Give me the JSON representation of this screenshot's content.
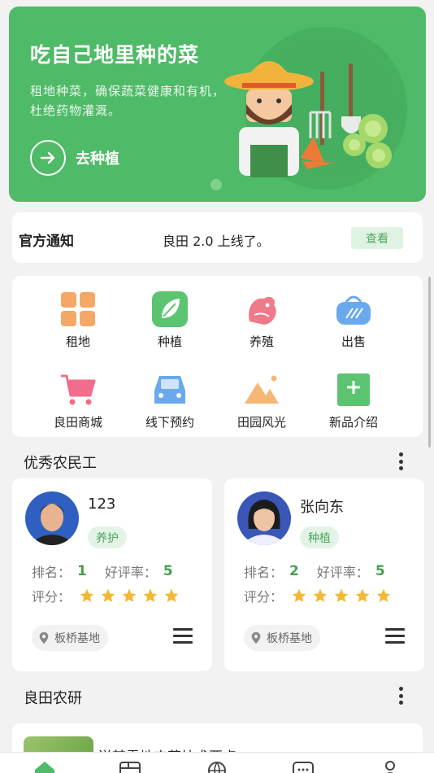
{
  "banner": {
    "title": "吃自己地里种的菜",
    "description": "租地种菜，确保蔬菜健康和有机，杜绝药物灌溉。",
    "cta_label": "去种植",
    "bg_color": "#4fba67"
  },
  "notice": {
    "title": "官方通知",
    "text": "良田 2.0 上线了。",
    "button_label": "查看"
  },
  "menu": {
    "items": [
      {
        "label": "租地",
        "icon": "land-grid-icon",
        "color": "#f5a766"
      },
      {
        "label": "种植",
        "icon": "leaf-icon",
        "color": "#5cc470"
      },
      {
        "label": "养殖",
        "icon": "chicken-icon",
        "color": "#f07a8a"
      },
      {
        "label": "出售",
        "icon": "bag-icon",
        "color": "#6aa9ee"
      },
      {
        "label": "良田商城",
        "icon": "cart-icon",
        "color": "#f06d8c"
      },
      {
        "label": "线下预约",
        "icon": "car-icon",
        "color": "#6aa9ee"
      },
      {
        "label": "田园风光",
        "icon": "mountain-icon",
        "color": "#f5b774"
      },
      {
        "label": "新品介绍",
        "icon": "plus-square-icon",
        "color": "#5cc470"
      }
    ]
  },
  "workers_section": {
    "title": "优秀农民工",
    "workers": [
      {
        "name": "123",
        "tag": "养护",
        "rank_label": "排名：",
        "rank": "1",
        "rate_label": "好评率：",
        "rate": "5",
        "score_label": "评分：",
        "stars": 5,
        "location": "板桥基地"
      },
      {
        "name": "张向东",
        "tag": "种植",
        "rank_label": "排名：",
        "rank": "2",
        "rate_label": "好评率：",
        "rate": "5",
        "score_label": "评分：",
        "stars": 5,
        "location": "板桥基地"
      }
    ]
  },
  "research_section": {
    "title": "良田农研",
    "item_title": "送某雷地农药技术要点"
  },
  "tabbar": {
    "tabs": [
      {
        "icon": "home-icon"
      },
      {
        "icon": "field-icon"
      },
      {
        "icon": "globe-icon"
      },
      {
        "icon": "chat-icon"
      },
      {
        "icon": "user-icon"
      }
    ]
  }
}
